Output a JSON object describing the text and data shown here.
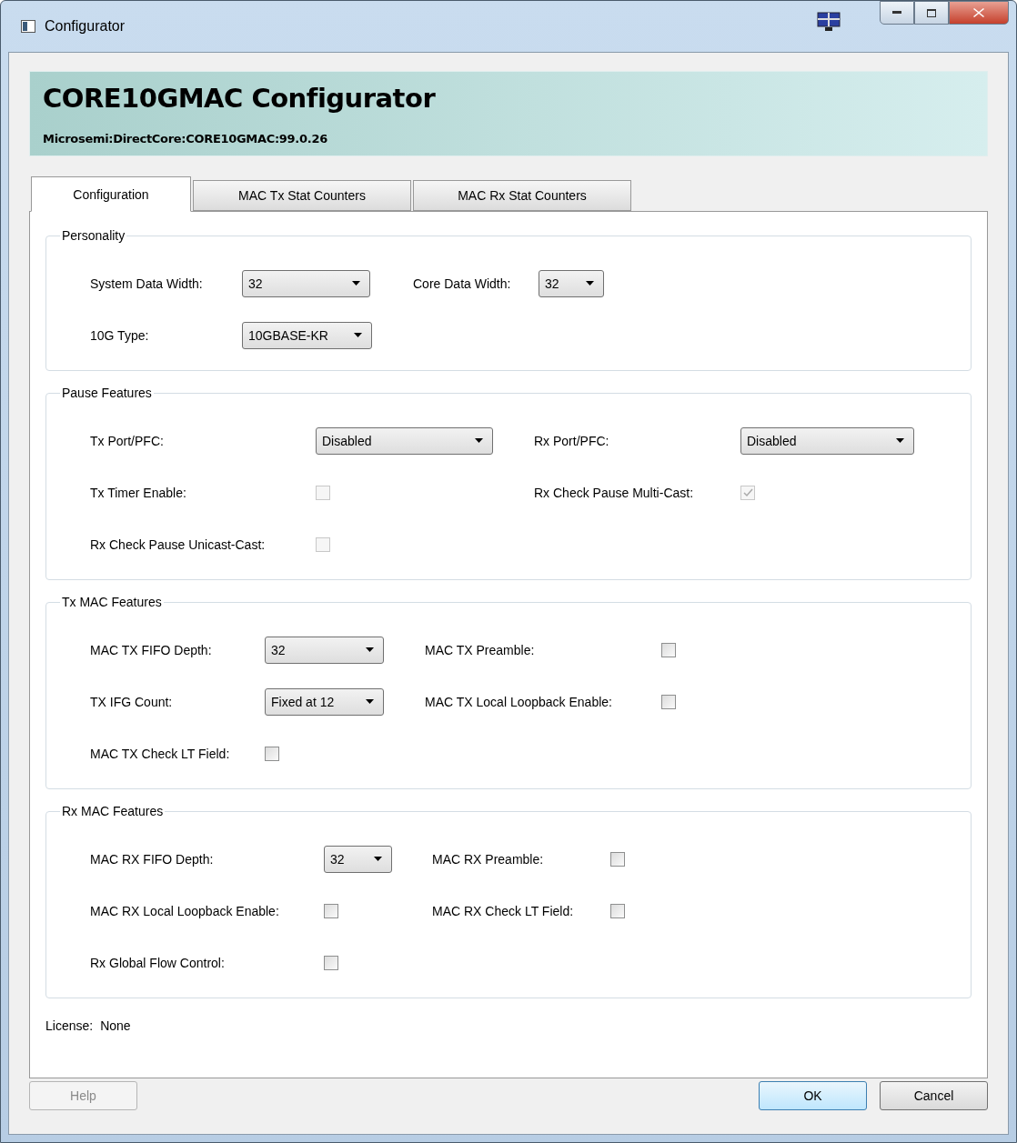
{
  "window": {
    "title": "Configurator"
  },
  "header": {
    "title": "CORE10GMAC Configurator",
    "subtitle": "Microsemi:DirectCore:CORE10GMAC:99.0.26"
  },
  "tabs": [
    {
      "label": "Configuration",
      "selected": true
    },
    {
      "label": "MAC Tx Stat Counters",
      "selected": false
    },
    {
      "label": "MAC Rx Stat Counters",
      "selected": false
    }
  ],
  "sections": [
    {
      "title": "Personality",
      "rows": [
        [
          {
            "label": "System Data Width:",
            "kind": "dropdown",
            "value": "32"
          },
          {
            "label": "Core Data Width:",
            "kind": "dropdown",
            "value": "32"
          }
        ],
        [
          {
            "label": "10G Type:",
            "kind": "dropdown",
            "value": "10GBASE-KR"
          }
        ]
      ]
    },
    {
      "title": "Pause Features",
      "rows": [
        [
          {
            "label": "Tx Port/PFC:",
            "kind": "dropdown",
            "value": "Disabled"
          },
          {
            "label": "Rx Port/PFC:",
            "kind": "dropdown",
            "value": "Disabled"
          }
        ],
        [
          {
            "label": "Tx Timer Enable:",
            "kind": "checkbox",
            "checked": false,
            "disabled": true
          },
          {
            "label": "Rx Check Pause Multi-Cast:",
            "kind": "checkbox",
            "checked": true,
            "disabled": true
          }
        ],
        [
          {
            "label": "Rx Check Pause Unicast-Cast:",
            "kind": "checkbox",
            "checked": false,
            "disabled": true
          }
        ]
      ]
    },
    {
      "title": "Tx MAC Features",
      "rows": [
        [
          {
            "label": "MAC TX FIFO Depth:",
            "kind": "dropdown",
            "value": "32"
          },
          {
            "label": "MAC TX Preamble:",
            "kind": "checkbox",
            "checked": false,
            "disabled": false
          }
        ],
        [
          {
            "label": "TX IFG Count:",
            "kind": "dropdown",
            "value": "Fixed at 12"
          },
          {
            "label": "MAC TX Local Loopback Enable:",
            "kind": "checkbox",
            "checked": false,
            "disabled": false
          }
        ],
        [
          {
            "label": "MAC TX Check LT Field:",
            "kind": "checkbox",
            "checked": false,
            "disabled": false
          }
        ]
      ]
    },
    {
      "title": "Rx MAC Features",
      "rows": [
        [
          {
            "label": "MAC RX FIFO Depth:",
            "kind": "dropdown",
            "value": "32"
          },
          {
            "label": "MAC RX Preamble:",
            "kind": "checkbox",
            "checked": false,
            "disabled": false
          }
        ],
        [
          {
            "label": "MAC RX Local Loopback Enable:",
            "kind": "checkbox",
            "checked": false,
            "disabled": false
          },
          {
            "label": "MAC RX Check LT Field:",
            "kind": "checkbox",
            "checked": false,
            "disabled": false
          }
        ],
        [
          {
            "label": "Rx Global Flow Control:",
            "kind": "checkbox",
            "checked": false,
            "disabled": false
          }
        ]
      ]
    }
  ],
  "license": {
    "label": "License:",
    "value": "None"
  },
  "buttons": [
    {
      "label": "Help",
      "disabled": true,
      "default": false
    },
    {
      "label": "OK",
      "disabled": false,
      "default": true
    },
    {
      "label": "Cancel",
      "disabled": false,
      "default": false
    }
  ]
}
